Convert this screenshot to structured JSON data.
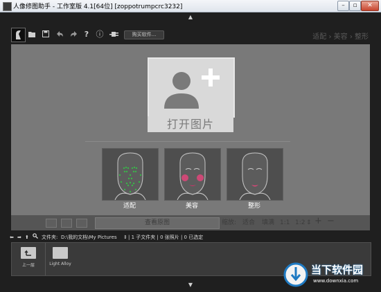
{
  "window": {
    "title": "人像修图助手 - 工作室版 4.1[64位] [zoppotrumpcrc3232]",
    "minimize": "–",
    "restore": "▫",
    "close": "✕"
  },
  "toolbar": {
    "buy_button": "购买软件...",
    "breadcrumb": "适配 › 美容 › 整形",
    "help": "?",
    "info": "ⓘ"
  },
  "open_panel": {
    "label": "打开图片"
  },
  "modes": [
    {
      "label": "适配"
    },
    {
      "label": "美容"
    },
    {
      "label": "整形"
    }
  ],
  "bottom_toolbar": {
    "view_original": "查看原图",
    "zoom_label": "缩放:",
    "fit": "适合",
    "fill": "填满",
    "one_to_one": "1:1",
    "one_to_two": "1:2",
    "plus": "+",
    "minus": "−"
  },
  "path_bar": {
    "folder_label": "文件夹:",
    "path": "D:\\我的文档\\My Pictures",
    "stats": "| 1 子文件夹 | 0 张照片 | 0 已选定"
  },
  "file_browser": {
    "items": [
      {
        "label": "上一层"
      },
      {
        "label": "Light Alloy"
      }
    ]
  },
  "watermark": {
    "brand": "当下软件园",
    "url": "www.downxia.com"
  },
  "colors": {
    "work_area": "#797979",
    "frame": "#1f1f1f",
    "dot_green": "#3ab54a",
    "blush": "#e0457a"
  }
}
